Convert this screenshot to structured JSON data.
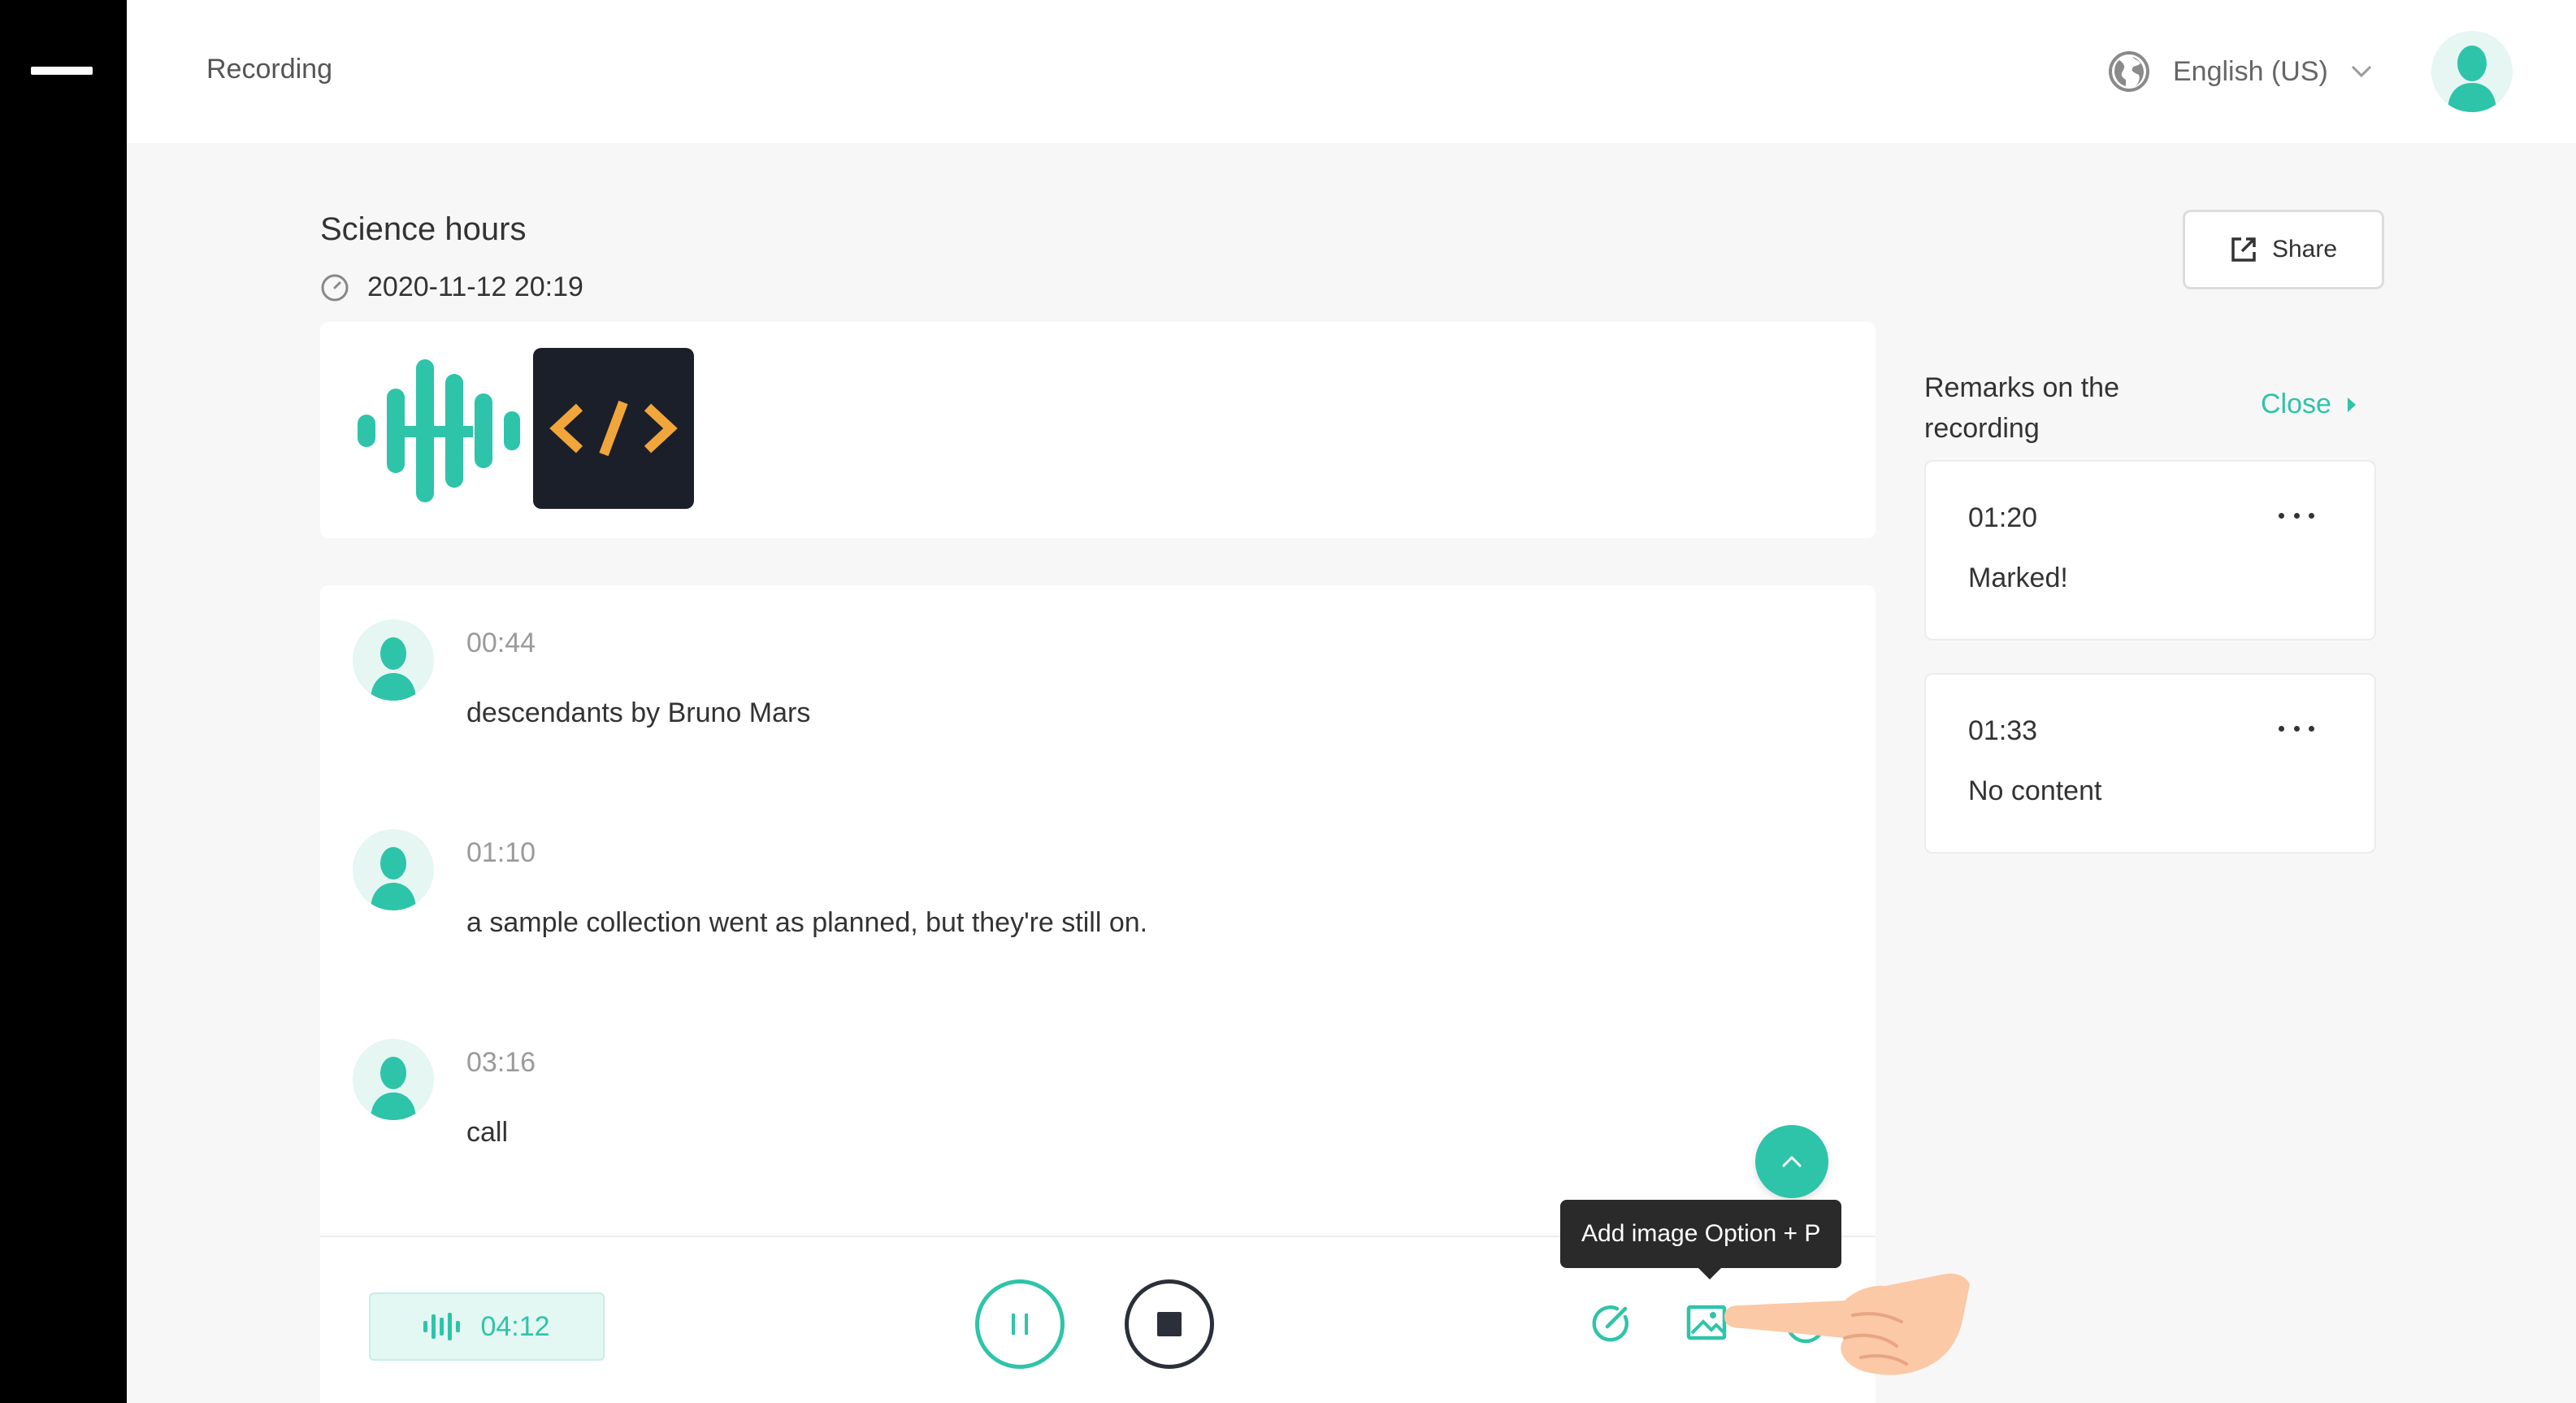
{
  "header": {
    "title": "Recording",
    "language": "English (US)",
    "icons": {
      "language": "globe-icon",
      "dropdown": "chevron-down-icon",
      "avatar": "user-avatar"
    }
  },
  "recording": {
    "title": "Science hours",
    "datetime": "2020-11-12 20:19"
  },
  "share": {
    "label": "Share"
  },
  "transcript": [
    {
      "time": "00:44",
      "text": "descendants by Bruno Mars"
    },
    {
      "time": "01:10",
      "text": " a sample collection went as planned, but they're still on."
    },
    {
      "time": "03:16",
      "text": "call"
    }
  ],
  "player": {
    "duration": "04:12",
    "tooltip": "Add image Option + P"
  },
  "remarks": {
    "title": "Remarks on the recording",
    "close_label": "Close",
    "items": [
      {
        "time": "01:20",
        "text": "Marked!"
      },
      {
        "time": "01:33",
        "text": "No content"
      }
    ]
  },
  "colors": {
    "accent": "#2ec4a9",
    "sidebar": "#000000",
    "dark": "#2b2f3a",
    "code_orange": "#f0a63a"
  }
}
